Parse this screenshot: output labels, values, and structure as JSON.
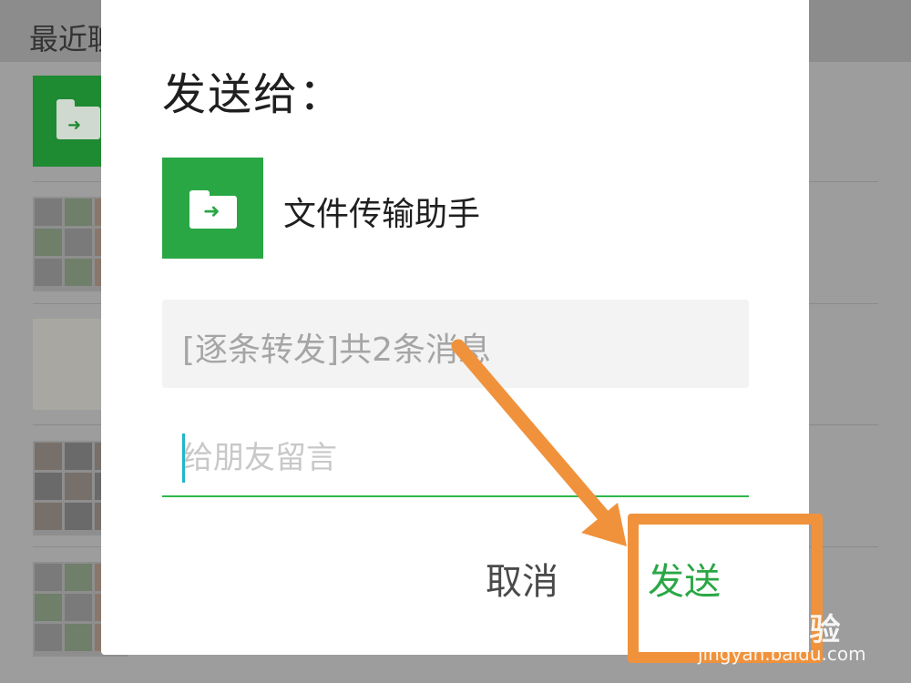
{
  "background": {
    "header_text": "最近聊"
  },
  "dialog": {
    "title": "发送给：",
    "recipient": {
      "name": "文件传输助手",
      "icon": "folder-arrow-icon"
    },
    "message_preview": "[逐条转发]共2条消息",
    "note_placeholder": "给朋友留言",
    "cancel_label": "取消",
    "send_label": "发送"
  },
  "colors": {
    "wechat_green": "#2aa745",
    "annotation_orange": "#f0923c",
    "input_underline": "#2db84a"
  },
  "watermark": {
    "logo": "Baidu经验",
    "url": "jingyan.baidu.com"
  }
}
